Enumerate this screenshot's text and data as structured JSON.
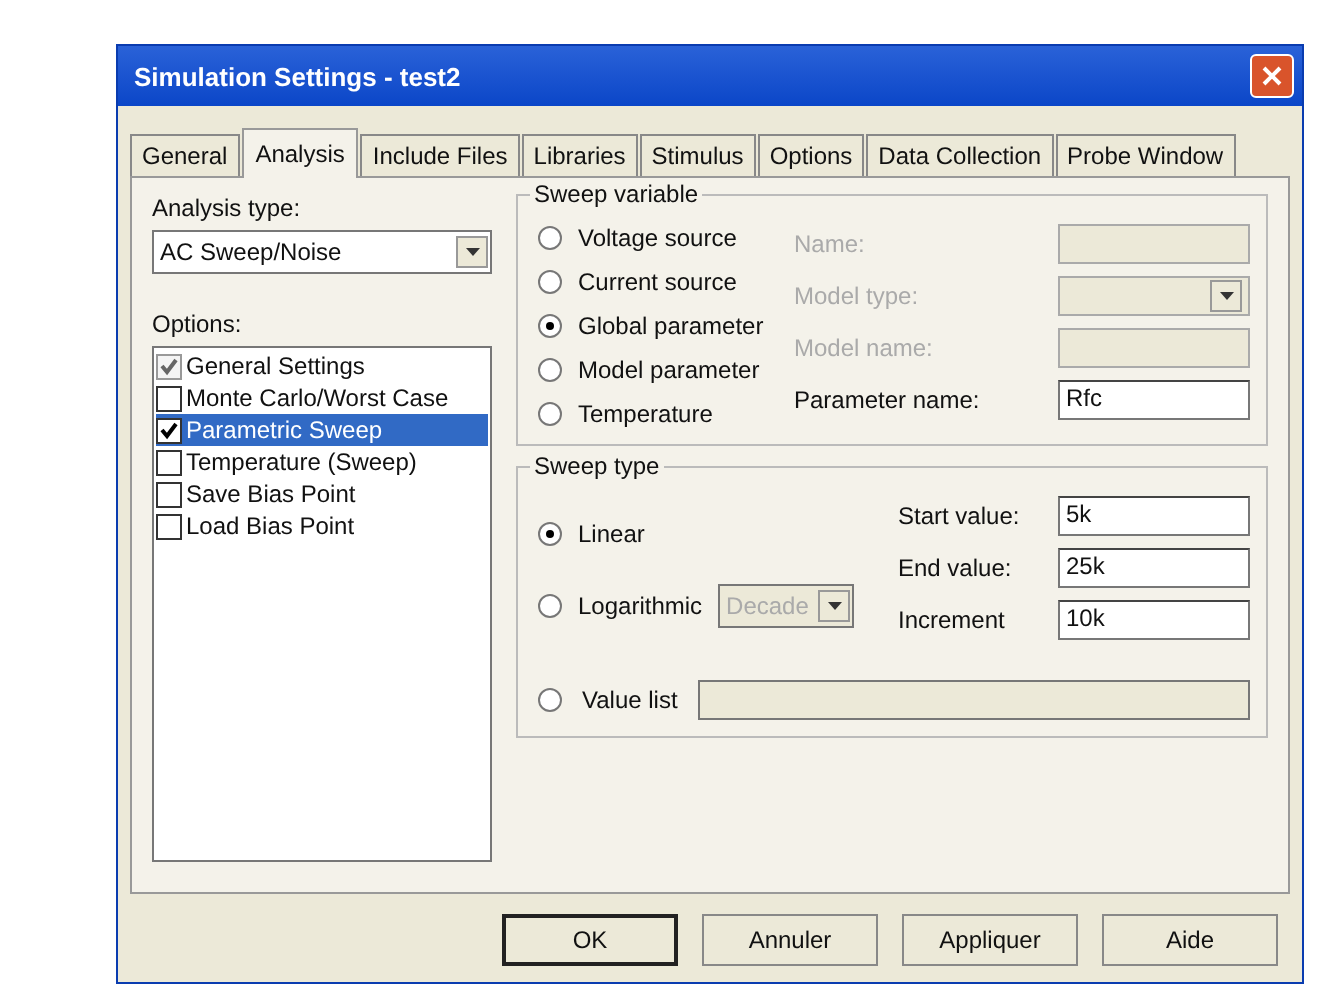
{
  "window": {
    "title": "Simulation Settings - test2"
  },
  "tabs": [
    {
      "label": "General",
      "selected": false
    },
    {
      "label": "Analysis",
      "selected": true
    },
    {
      "label": "Include Files",
      "selected": false
    },
    {
      "label": "Libraries",
      "selected": false
    },
    {
      "label": "Stimulus",
      "selected": false
    },
    {
      "label": "Options",
      "selected": false
    },
    {
      "label": "Data Collection",
      "selected": false
    },
    {
      "label": "Probe Window",
      "selected": false
    }
  ],
  "analysis_type": {
    "label": "Analysis type:",
    "value": "AC Sweep/Noise"
  },
  "options": {
    "label": "Options:",
    "items": [
      {
        "label": "General Settings",
        "checked": true,
        "disabled": true,
        "selected": false
      },
      {
        "label": "Monte Carlo/Worst Case",
        "checked": false,
        "disabled": false,
        "selected": false
      },
      {
        "label": "Parametric Sweep",
        "checked": true,
        "disabled": false,
        "selected": true
      },
      {
        "label": "Temperature (Sweep)",
        "checked": false,
        "disabled": false,
        "selected": false
      },
      {
        "label": "Save Bias Point",
        "checked": false,
        "disabled": false,
        "selected": false
      },
      {
        "label": "Load Bias Point",
        "checked": false,
        "disabled": false,
        "selected": false
      }
    ]
  },
  "sweep_variable": {
    "title": "Sweep variable",
    "radios": [
      {
        "label": "Voltage source",
        "selected": false
      },
      {
        "label": "Current source",
        "selected": false
      },
      {
        "label": "Global parameter",
        "selected": true
      },
      {
        "label": "Model parameter",
        "selected": false
      },
      {
        "label": "Temperature",
        "selected": false
      }
    ],
    "fields": [
      {
        "label": "Name:",
        "kind": "text",
        "disabled": true
      },
      {
        "label": "Model type:",
        "kind": "dropdown",
        "disabled": true
      },
      {
        "label": "Model name:",
        "kind": "text",
        "disabled": true
      },
      {
        "label": "Parameter name:",
        "kind": "text",
        "disabled": false,
        "value": "Rfc"
      }
    ]
  },
  "sweep_type": {
    "title": "Sweep type",
    "radios": [
      {
        "label": "Linear",
        "selected": true
      },
      {
        "label": "Logarithmic",
        "selected": false,
        "dropdown": "Decade"
      }
    ],
    "value_list": {
      "label": "Value list",
      "selected": false
    },
    "fields": [
      {
        "label": "Start value:",
        "value": "5k"
      },
      {
        "label": "End value:",
        "value": "25k"
      },
      {
        "label": "Increment",
        "value": "10k"
      }
    ]
  },
  "buttons": [
    {
      "label": "OK",
      "default": true
    },
    {
      "label": "Annuler",
      "default": false
    },
    {
      "label": "Appliquer",
      "default": false
    },
    {
      "label": "Aide",
      "default": false
    }
  ]
}
